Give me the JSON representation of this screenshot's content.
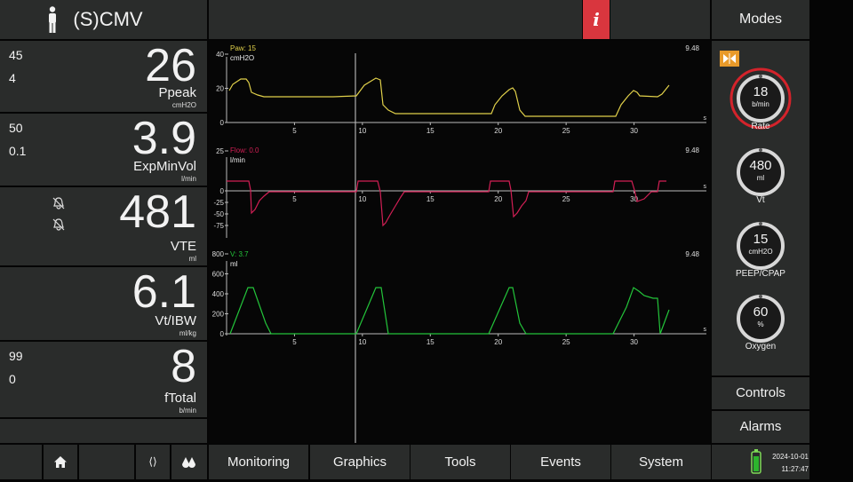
{
  "header": {
    "mode": "(S)CMV",
    "info_label": "i",
    "modes_label": "Modes"
  },
  "params": [
    {
      "id": "ppeak",
      "limits": [
        "45",
        "4"
      ],
      "value": "26",
      "name": "Ppeak",
      "unit": "cmH2O"
    },
    {
      "id": "expminvol",
      "limits": [
        "50",
        "0.1"
      ],
      "value": "3.9",
      "name": "ExpMinVol",
      "unit": "l/min"
    },
    {
      "id": "vte",
      "limits": [],
      "value": "481",
      "name": "VTE",
      "unit": "ml"
    },
    {
      "id": "vtibw",
      "limits": [],
      "value": "6.1",
      "name": "Vt/IBW",
      "unit": "ml/kg"
    },
    {
      "id": "ftotal",
      "limits": [
        "99",
        "0"
      ],
      "value": "8",
      "name": "fTotal",
      "unit": "b/min"
    }
  ],
  "waveforms": [
    {
      "id": "paw",
      "label": "Paw: 15",
      "unit": "cmH2O",
      "color": "#e0d04a",
      "scale_max": "9.48",
      "yticks": [
        "40",
        "20",
        "0"
      ],
      "ymin": 0,
      "ymax": 40
    },
    {
      "id": "flow",
      "label": "Flow: 0.0",
      "unit": "l/min",
      "color": "#d21f55",
      "scale_max": "9.48",
      "yticks": [
        "25",
        "0",
        "-25",
        "-50",
        "-75"
      ],
      "ymin": -75,
      "ymax": 25
    },
    {
      "id": "vol",
      "label": "V: 3.7",
      "unit": "ml",
      "color": "#23c43a",
      "scale_max": "9.48",
      "yticks": [
        "800",
        "600",
        "400",
        "200",
        "0"
      ],
      "ymin": 0,
      "ymax": 800
    }
  ],
  "time_axis": {
    "ticks": [
      "5",
      "10",
      "15",
      "20",
      "25",
      "30"
    ],
    "unit": "s"
  },
  "controls": [
    {
      "id": "rate",
      "value": "18",
      "unit": "b/min",
      "label": "Rate",
      "active": true
    },
    {
      "id": "vt",
      "value": "480",
      "unit": "ml",
      "label": "Vt",
      "active": false
    },
    {
      "id": "peep",
      "value": "15",
      "unit": "cmH2O",
      "label": "PEEP/CPAP",
      "active": false
    },
    {
      "id": "oxygen",
      "value": "60",
      "unit": "%",
      "label": "Oxygen",
      "active": false
    }
  ],
  "right_buttons": {
    "controls": "Controls",
    "alarms": "Alarms"
  },
  "bottom_tabs": [
    "Monitoring",
    "Graphics",
    "Tools",
    "Events",
    "System"
  ],
  "bottom_icons": {
    "home": "home-icon",
    "brackets": "brackets-icon",
    "drops": "drops-icon"
  },
  "brackets_glyph": "⟨⟩",
  "status": {
    "date": "2024-10-01",
    "time": "11:27:47"
  },
  "colors": {
    "panel": "#2a2c2b",
    "info": "#d9363e",
    "alert_ring": "#d4232b",
    "freeze": "#e89a2a"
  }
}
